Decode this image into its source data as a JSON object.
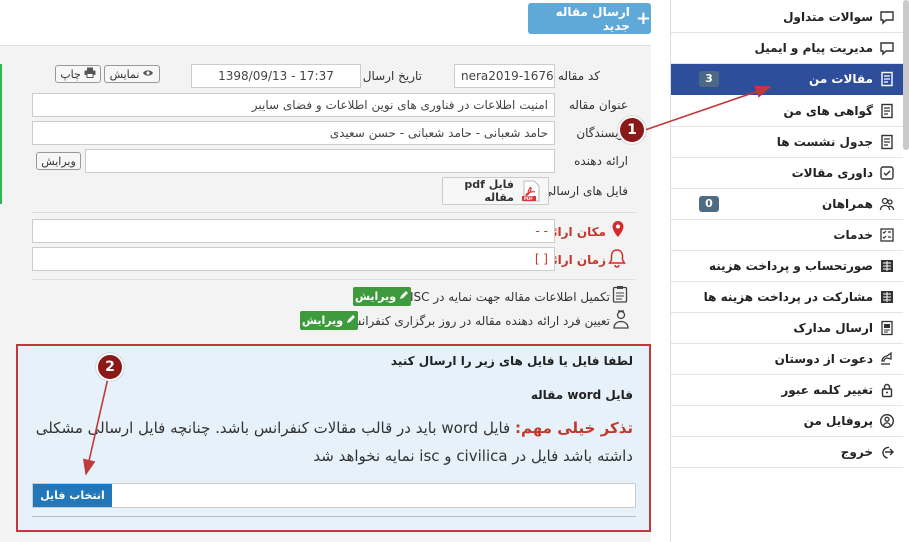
{
  "sidebar": {
    "items": [
      {
        "label": "سوالات متداول",
        "icon": "chat-icon",
        "badge": ""
      },
      {
        "label": "مدیریت پیام و ایمیل",
        "icon": "chat-icon",
        "badge": ""
      },
      {
        "label": "مقالات من",
        "icon": "document-icon",
        "badge": "3",
        "active": true
      },
      {
        "label": "گواهی های من",
        "icon": "document-icon",
        "badge": ""
      },
      {
        "label": "جدول نشست ها",
        "icon": "document-icon",
        "badge": ""
      },
      {
        "label": "داوری مقالات",
        "icon": "review-icon",
        "badge": ""
      },
      {
        "label": "همراهان",
        "icon": "people-icon",
        "badge": "0"
      },
      {
        "label": "خدمات",
        "icon": "checklist-icon",
        "badge": ""
      },
      {
        "label": "صورتحساب و پرداخت هزینه",
        "icon": "invoice-icon",
        "badge": ""
      },
      {
        "label": "مشارکت در پرداخت هزینه ها",
        "icon": "invoice-icon",
        "badge": ""
      },
      {
        "label": "ارسال مدارک",
        "icon": "upload-doc-icon",
        "badge": ""
      },
      {
        "label": "دعوت از دوستان",
        "icon": "invite-icon",
        "badge": ""
      },
      {
        "label": "تغییر کلمه عبور",
        "icon": "lock-icon",
        "badge": ""
      },
      {
        "label": "پروفایل من",
        "icon": "profile-icon",
        "badge": ""
      },
      {
        "label": "خروج",
        "icon": "logout-icon",
        "badge": ""
      }
    ]
  },
  "toolbar": {
    "new_article": "ارسال مقاله جدید"
  },
  "article": {
    "code_label": "کد مقاله",
    "code_value": "nera2019-1676",
    "date_label": "تاریخ ارسال",
    "date_value": "1398/09/13 - 17:37",
    "show_btn": "نمایش",
    "print_btn": "چاپ",
    "title_label": "عنوان مقاله",
    "title_value": "امنیت اطلاعات در فناوری های نوین اطلاعات و فضای سایبر",
    "authors_label": "نویسندگان",
    "authors_value": "حامد شعبانی - حامد شعبانی - حسن سعیدی",
    "presenter_label": "ارائه دهنده",
    "presenter_value": "",
    "edit_btn": "ویرایش",
    "files_label": "فایل های ارسالی",
    "pdf_file": "فایل pdf مقاله",
    "pdf_badge": "PDF",
    "place_label": "مکان ارائه",
    "place_value": "- -",
    "time_label": "زمان ارائه",
    "time_value": "[ ]",
    "isc_text": "تکمیل اطلاعات مقاله جهت نمایه در ISC",
    "isc_btn": "ویرایش",
    "presenter_day_text": "تعیین فرد ارائه دهنده مقاله در روز برگزاری کنفرانس",
    "presenter_day_btn": "ویرایش"
  },
  "upload": {
    "title": "لطفا فایل یا فایل های زیر را ارسال کنید",
    "file_type": "فایل word مقاله",
    "warning_label": "تذکر خیلی مهم:",
    "warning_text": "فایل word باید در قالب مقالات کنفرانس باشد. چنانچه فایل ارسالی مشکلی داشته باشد فایل در civilica و isc نمایه نخواهد شد",
    "choose_btn": "انتخاب فایل"
  },
  "callouts": {
    "one": "1",
    "two": "2"
  },
  "colors": {
    "active_nav": "#2e4d9b",
    "primary_button": "#5fa8d8",
    "edit_button": "#3d9a3d",
    "annotation": "#c0393b",
    "choose_button": "#2277bb"
  }
}
